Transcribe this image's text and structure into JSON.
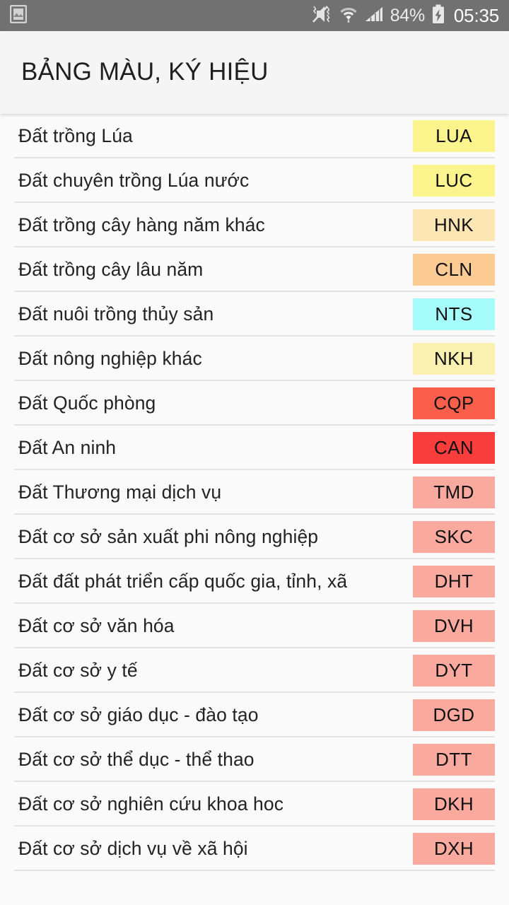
{
  "status_bar": {
    "background": "#717171",
    "notification_icon": "photo-icon",
    "icons": [
      "mute-vibrate-icon",
      "wifi-icon",
      "cellular-signal-icon"
    ],
    "battery_percent": "84%",
    "battery_icon": "battery-charging-icon",
    "clock": "05:35"
  },
  "app_bar": {
    "title": "BẢNG MÀU, KÝ HIỆU",
    "background": "#F5F5F5"
  },
  "list": {
    "rows": [
      {
        "label": "Đất trồng Lúa",
        "code": "LUA",
        "color": "#FBF38C"
      },
      {
        "label": "Đất chuyên trồng Lúa nước",
        "code": "LUC",
        "color": "#FBF38C"
      },
      {
        "label": "Đất trồng cây hàng năm khác",
        "code": "HNK",
        "color": "#FCE7B4"
      },
      {
        "label": "Đất trồng cây lâu năm",
        "code": "CLN",
        "color": "#FBCB93"
      },
      {
        "label": "Đất nuôi trồng thủy sản",
        "code": "NTS",
        "color": "#A6FBFB"
      },
      {
        "label": "Đất nông nghiệp khác",
        "code": "NKH",
        "color": "#FAF0B0"
      },
      {
        "label": "Đất Quốc phòng",
        "code": "CQP",
        "color": "#FB5E4A"
      },
      {
        "label": "Đất An ninh",
        "code": "CAN",
        "color": "#F93C3C"
      },
      {
        "label": "Đất Thương mại dịch vụ",
        "code": "TMD",
        "color": "#FAA99F"
      },
      {
        "label": "Đất cơ sở sản xuất phi nông nghiệp",
        "code": "SKC",
        "color": "#FAA99F"
      },
      {
        "label": "Đất đất phát triển cấp quốc gia, tỉnh, xã",
        "code": "DHT",
        "color": "#FAA99F"
      },
      {
        "label": "Đất cơ sở văn hóa",
        "code": "DVH",
        "color": "#FAA99F"
      },
      {
        "label": "Đất cơ sở y tế",
        "code": "DYT",
        "color": "#FAA99F"
      },
      {
        "label": "Đất cơ sở giáo dục - đào tạo",
        "code": "DGD",
        "color": "#FAA99F"
      },
      {
        "label": "Đất cơ sở thể dục - thể thao",
        "code": "DTT",
        "color": "#FAA99F"
      },
      {
        "label": "Đất cơ sở nghiên cứu khoa hoc",
        "code": "DKH",
        "color": "#FAA99F"
      },
      {
        "label": "Đất cơ sở dịch vụ về xã hội",
        "code": "DXH",
        "color": "#FAA99F"
      }
    ]
  }
}
